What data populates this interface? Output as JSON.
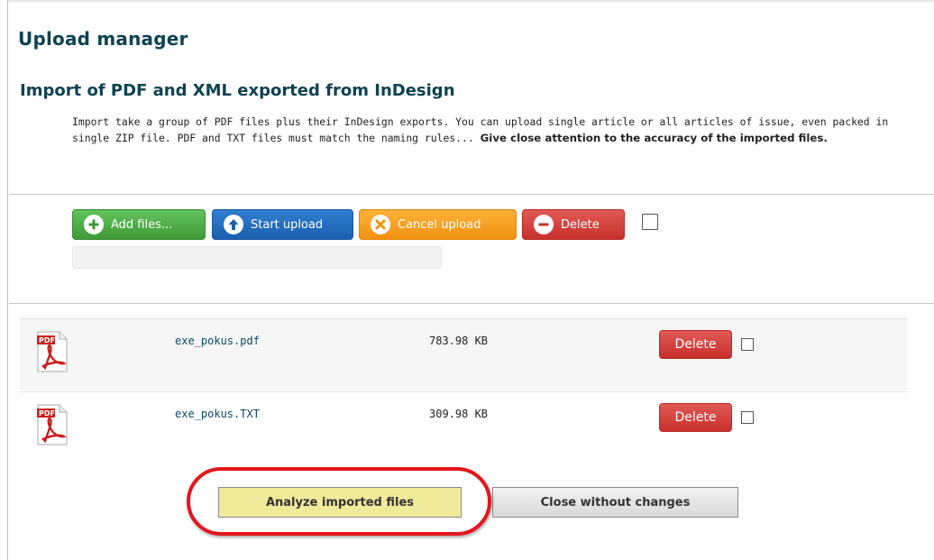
{
  "header": {
    "title": "Upload manager",
    "subtitle": "Import of PDF and XML exported from InDesign",
    "description_plain": "Import take a group of PDF files plus their InDesign exports. You can upload single article or all articles of issue, even packed in single ZIP file. PDF and TXT files must match the naming rules...",
    "description_bold": "Give close attention to the accuracy of the imported files."
  },
  "toolbar": {
    "add_files_label": "Add files...",
    "start_upload_label": "Start upload",
    "cancel_upload_label": "Cancel upload",
    "delete_label": "Delete"
  },
  "files": [
    {
      "icon": "pdf-file-icon",
      "name": "exe_pokus.pdf",
      "size": "783.98 KB",
      "delete_label": "Delete"
    },
    {
      "icon": "pdf-file-icon",
      "name": "exe_pokus.TXT",
      "size": "309.98 KB",
      "delete_label": "Delete"
    }
  ],
  "actions": {
    "analyze_label": "Analyze imported files",
    "close_label": "Close without changes"
  },
  "colors": {
    "heading": "#0d4352",
    "green": "#4cae4c",
    "blue": "#1f6ebf",
    "orange": "#f5a12a",
    "red": "#d9534f",
    "analyze_bg": "#f0ea9b",
    "highlight": "#e3161c"
  }
}
